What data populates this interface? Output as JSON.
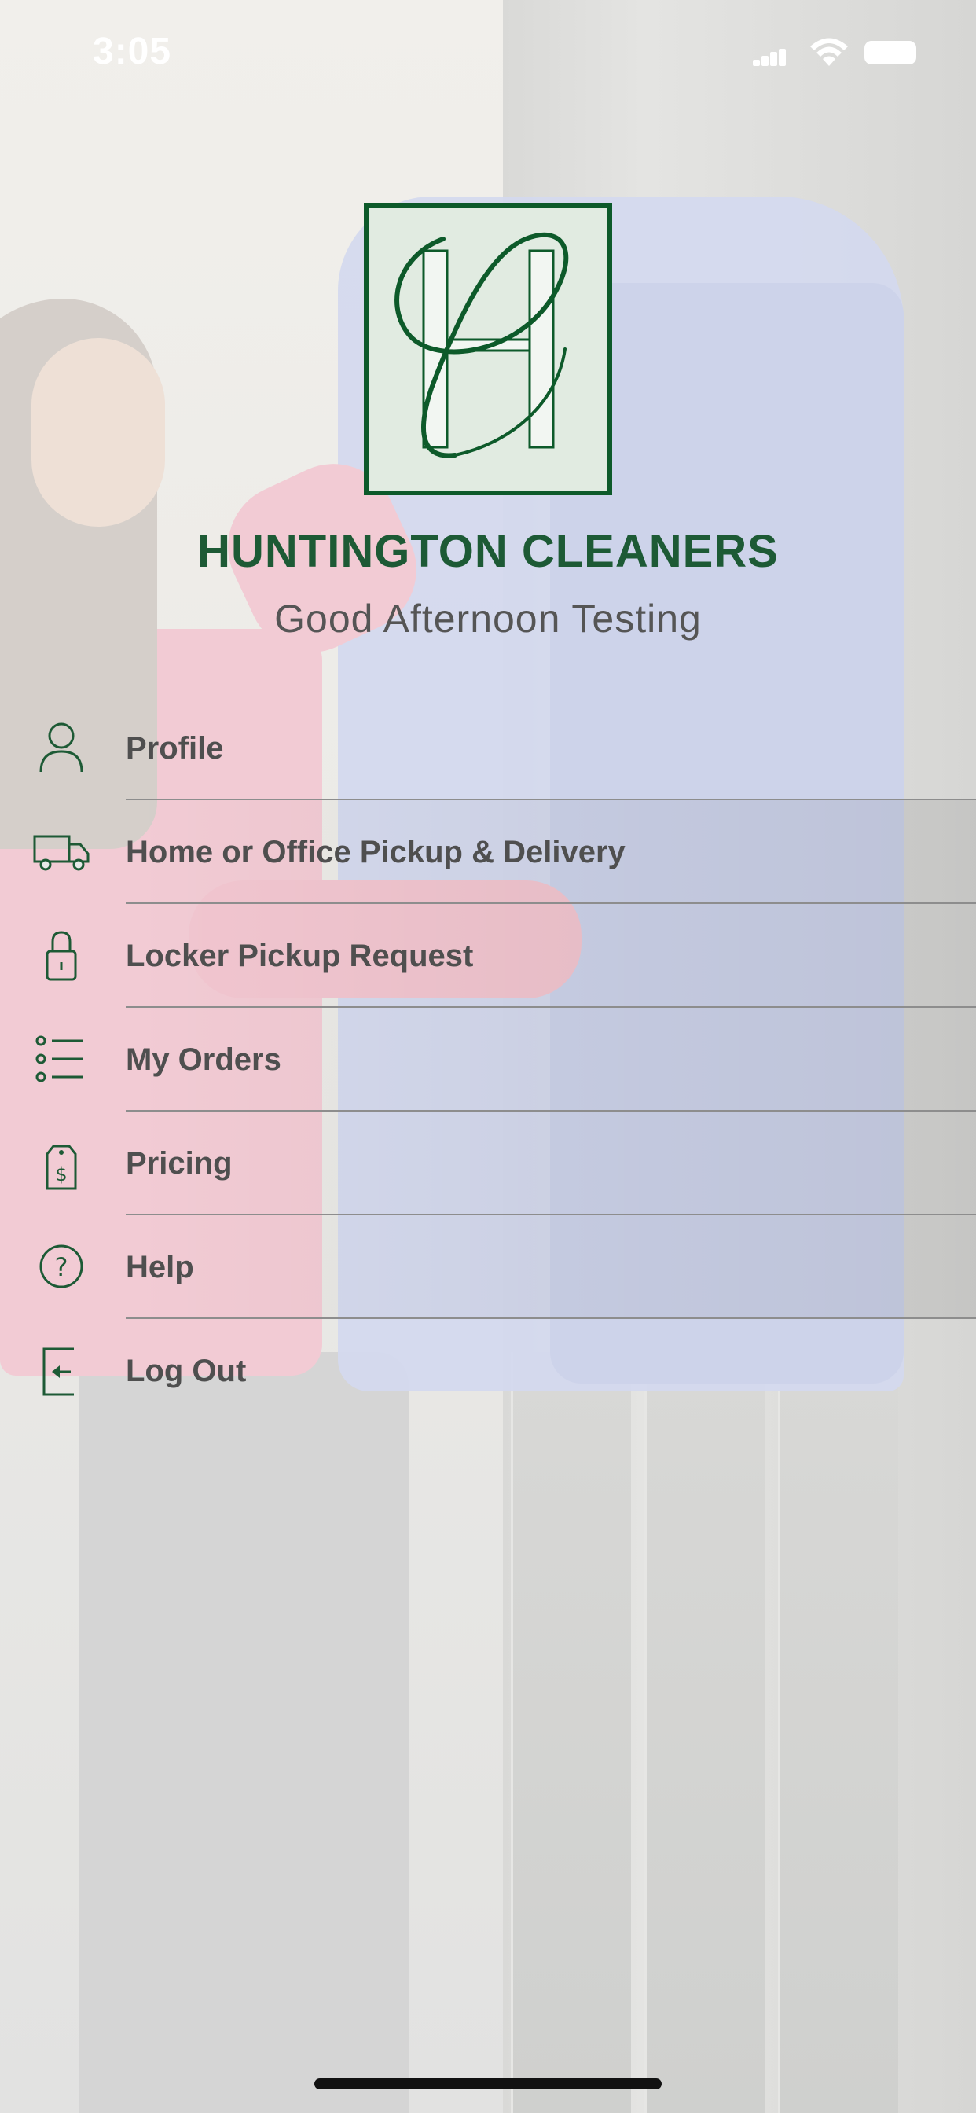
{
  "status_bar": {
    "time": "3:05"
  },
  "brand": {
    "logo_monogram": "HC",
    "name": "HUNTINGTON CLEANERS",
    "greeting": "Good Afternoon Testing",
    "colors": {
      "primary": "#0d5a2a",
      "logo_bg": "#e1ebe1",
      "text": "#4f4f4f"
    }
  },
  "menu": {
    "items": [
      {
        "label": "Profile",
        "icon": "person-icon"
      },
      {
        "label": "Home or Office Pickup & Delivery",
        "icon": "truck-icon"
      },
      {
        "label": "Locker Pickup Request",
        "icon": "lock-icon"
      },
      {
        "label": "My Orders",
        "icon": "list-icon"
      },
      {
        "label": "Pricing",
        "icon": "price-tag-icon"
      },
      {
        "label": "Help",
        "icon": "help-icon"
      },
      {
        "label": "Log Out",
        "icon": "logout-icon"
      }
    ]
  }
}
